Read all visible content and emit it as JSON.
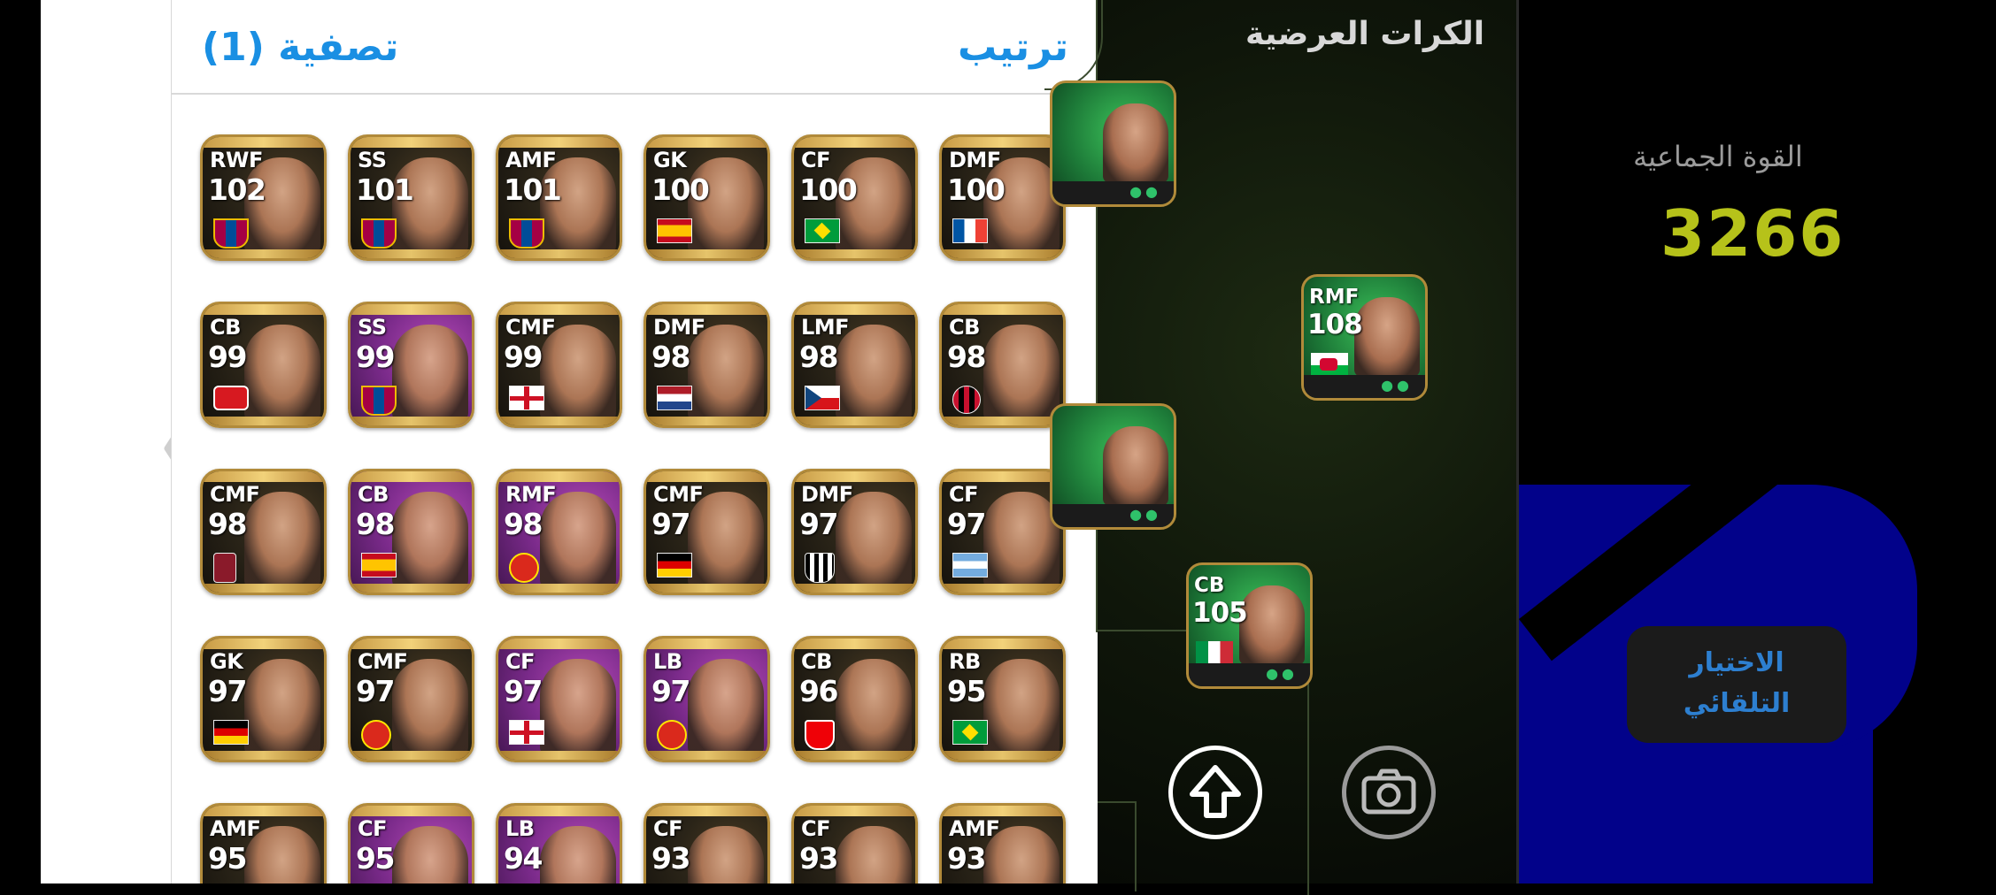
{
  "picker": {
    "filter_label": "تصفية (1)",
    "sort_label": "ترتيب"
  },
  "players": [
    {
      "pos": "RWF",
      "rating": "102",
      "bg": "black",
      "flag": "barca"
    },
    {
      "pos": "SS",
      "rating": "101",
      "bg": "black",
      "flag": "barca"
    },
    {
      "pos": "AMF",
      "rating": "101",
      "bg": "black",
      "flag": "barca"
    },
    {
      "pos": "GK",
      "rating": "100",
      "bg": "black",
      "flag": "spain"
    },
    {
      "pos": "CF",
      "rating": "100",
      "bg": "black",
      "flag": "brazil"
    },
    {
      "pos": "DMF",
      "rating": "100",
      "bg": "black",
      "flag": "france"
    },
    {
      "pos": "CB",
      "rating": "99",
      "bg": "black",
      "flag": "club-red"
    },
    {
      "pos": "SS",
      "rating": "99",
      "bg": "purple",
      "flag": "barca"
    },
    {
      "pos": "CMF",
      "rating": "99",
      "bg": "black",
      "flag": "england"
    },
    {
      "pos": "DMF",
      "rating": "98",
      "bg": "black",
      "flag": "netherlands"
    },
    {
      "pos": "LMF",
      "rating": "98",
      "bg": "black",
      "flag": "czech"
    },
    {
      "pos": "CB",
      "rating": "98",
      "bg": "black",
      "flag": "club-milan"
    },
    {
      "pos": "CMF",
      "rating": "98",
      "bg": "black",
      "flag": "club-lfc"
    },
    {
      "pos": "CB",
      "rating": "98",
      "bg": "purple",
      "flag": "spain"
    },
    {
      "pos": "RMF",
      "rating": "98",
      "bg": "purple",
      "flag": "club-mu"
    },
    {
      "pos": "CMF",
      "rating": "97",
      "bg": "black",
      "flag": "germany"
    },
    {
      "pos": "DMF",
      "rating": "97",
      "bg": "black",
      "flag": "club-juve"
    },
    {
      "pos": "CF",
      "rating": "97",
      "bg": "black",
      "flag": "argentina"
    },
    {
      "pos": "GK",
      "rating": "97",
      "bg": "black",
      "flag": "germany"
    },
    {
      "pos": "CMF",
      "rating": "97",
      "bg": "black",
      "flag": "club-mu"
    },
    {
      "pos": "CF",
      "rating": "97",
      "bg": "purple",
      "flag": "england"
    },
    {
      "pos": "LB",
      "rating": "97",
      "bg": "purple",
      "flag": "club-mu"
    },
    {
      "pos": "CB",
      "rating": "96",
      "bg": "black",
      "flag": "club-arsenal"
    },
    {
      "pos": "RB",
      "rating": "95",
      "bg": "black",
      "flag": "brazil"
    },
    {
      "pos": "AMF",
      "rating": "95",
      "bg": "black",
      "flag": "none"
    },
    {
      "pos": "CF",
      "rating": "95",
      "bg": "purple",
      "flag": "none"
    },
    {
      "pos": "LB",
      "rating": "94",
      "bg": "purple",
      "flag": "none"
    },
    {
      "pos": "CF",
      "rating": "93",
      "bg": "black",
      "flag": "none"
    },
    {
      "pos": "CF",
      "rating": "93",
      "bg": "black",
      "flag": "none"
    },
    {
      "pos": "AMF",
      "rating": "93",
      "bg": "black",
      "flag": "none"
    }
  ],
  "pitch": {
    "title": "الكرات العرضية",
    "cards": [
      {
        "pos": "",
        "rating": "",
        "flag": "none"
      },
      {
        "pos": "RMF",
        "rating": "108",
        "flag": "wales"
      },
      {
        "pos": "",
        "rating": "",
        "flag": "none"
      },
      {
        "pos": "CB",
        "rating": "105",
        "flag": "italy"
      }
    ]
  },
  "team": {
    "power_label": "القوة الجماعية",
    "power_value": "3266",
    "auto_select_line1": "الاختيار",
    "auto_select_line2": "التلقائي"
  },
  "colors": {
    "accent_blue": "#1a8fe3",
    "power_yellow": "#b6c21a",
    "auto_select_text": "#2d7fd0",
    "card_gold": "#b18a3a"
  },
  "icons": {
    "back": "chevron-left-icon",
    "share": "upload-arrow-icon",
    "camera": "camera-icon"
  }
}
